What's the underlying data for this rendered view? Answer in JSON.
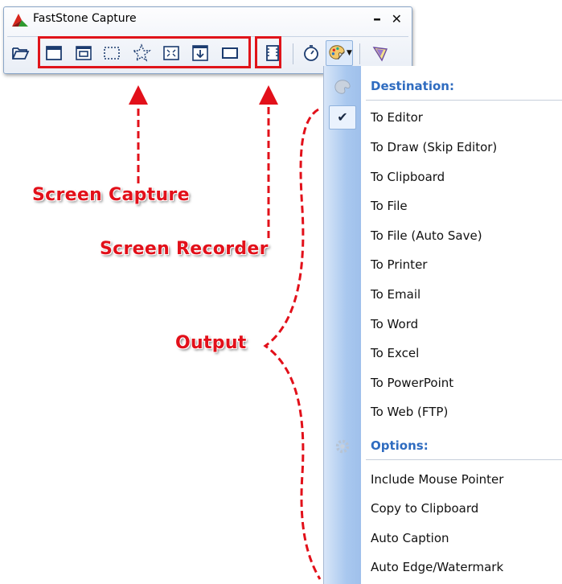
{
  "window": {
    "title": "FastStone Capture",
    "minimize_glyph": "–",
    "close_glyph": "✕"
  },
  "toolbar": {
    "icons": [
      "open-folder-icon",
      "capture-active-window-icon",
      "capture-window-object-icon",
      "capture-rectangular-region-icon",
      "capture-freehand-region-icon",
      "capture-full-screen-icon",
      "capture-scrolling-window-icon",
      "capture-fixed-region-icon",
      "screen-recorder-icon",
      "delay-timer-icon",
      "output-destination-icon",
      "settings-icon"
    ]
  },
  "annotations": {
    "screen_capture": "Screen Capture",
    "screen_recorder": "Screen Recorder",
    "output": "Output",
    "color": "#e2101a"
  },
  "menu": {
    "destination_header": "Destination:",
    "destinations": [
      {
        "label": "To Editor",
        "checked": true
      },
      {
        "label": "To Draw (Skip Editor)",
        "checked": false
      },
      {
        "label": "To Clipboard",
        "checked": false
      },
      {
        "label": "To File",
        "checked": false
      },
      {
        "label": "To File (Auto Save)",
        "checked": false
      },
      {
        "label": "To Printer",
        "checked": false
      },
      {
        "label": "To Email",
        "checked": false
      },
      {
        "label": "To Word",
        "checked": false
      },
      {
        "label": "To Excel",
        "checked": false
      },
      {
        "label": "To PowerPoint",
        "checked": false
      },
      {
        "label": "To Web (FTP)",
        "checked": false
      }
    ],
    "options_header": "Options:",
    "options": [
      {
        "label": "Include Mouse Pointer"
      },
      {
        "label": "Copy to Clipboard"
      },
      {
        "label": "Auto Caption"
      },
      {
        "label": "Auto Edge/Watermark"
      }
    ],
    "check_glyph": "✔",
    "header_color": "#2f6cc0"
  }
}
